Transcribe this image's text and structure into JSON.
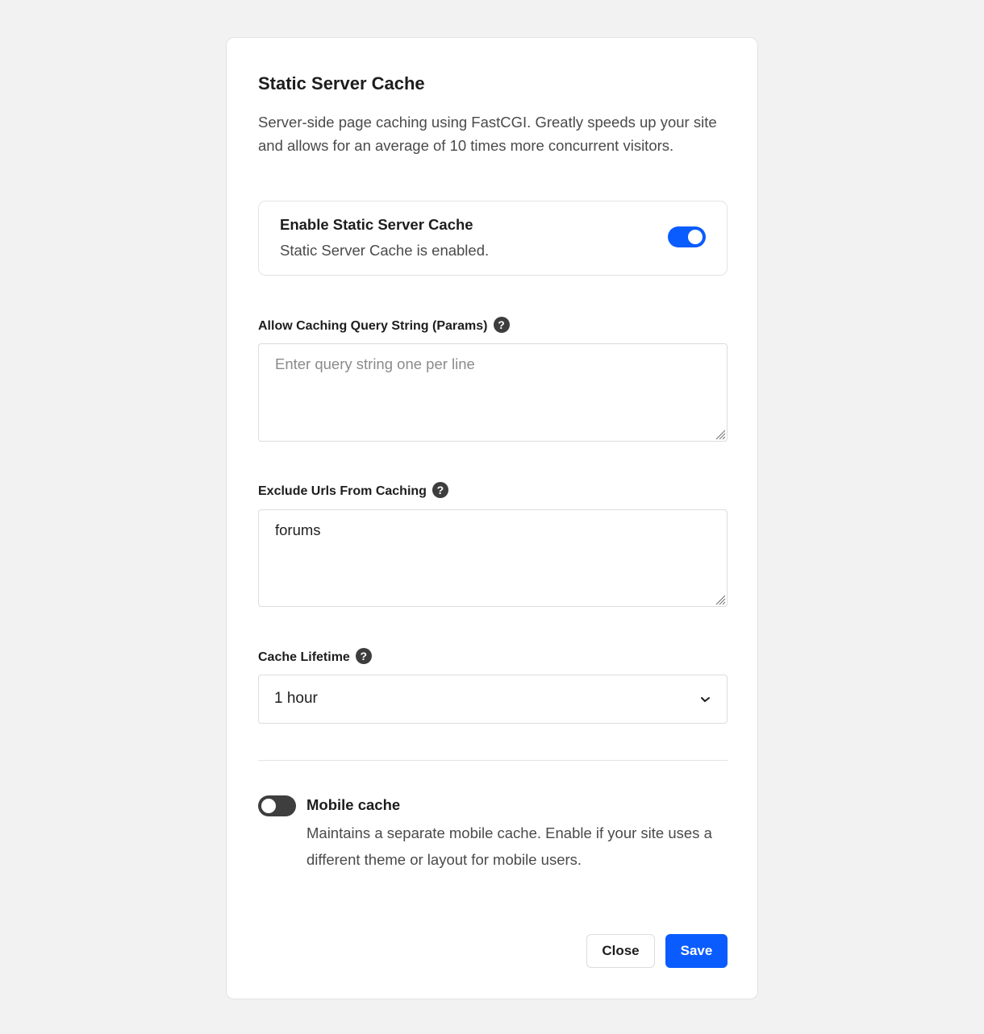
{
  "modal": {
    "title": "Static Server Cache",
    "description": "Server-side page caching using FastCGI. Greatly speeds up your site and allows for an average of 10 times more concurrent visitors."
  },
  "enable_card": {
    "title": "Enable Static Server Cache",
    "status": "Static Server Cache is enabled.",
    "enabled": true
  },
  "query_string_field": {
    "label": "Allow Caching Query String (Params)",
    "placeholder": "Enter query string one per line",
    "value": ""
  },
  "exclude_urls_field": {
    "label": "Exclude Urls From Caching",
    "value": "forums"
  },
  "cache_lifetime": {
    "label": "Cache Lifetime",
    "selected": "1 hour"
  },
  "mobile_cache": {
    "title": "Mobile cache",
    "description": "Maintains a separate mobile cache. Enable if your site uses a different theme or layout for mobile users.",
    "enabled": false
  },
  "footer": {
    "close_label": "Close",
    "save_label": "Save"
  },
  "help_glyph": "?",
  "colors": {
    "accent": "#0a5cff",
    "toggle_off": "#3e3e3e",
    "background": "#f2f2f2"
  },
  "icons": {
    "help": "question-mark-circle-icon",
    "dropdown": "chevron-down-icon",
    "resize": "resize-handle-icon"
  }
}
